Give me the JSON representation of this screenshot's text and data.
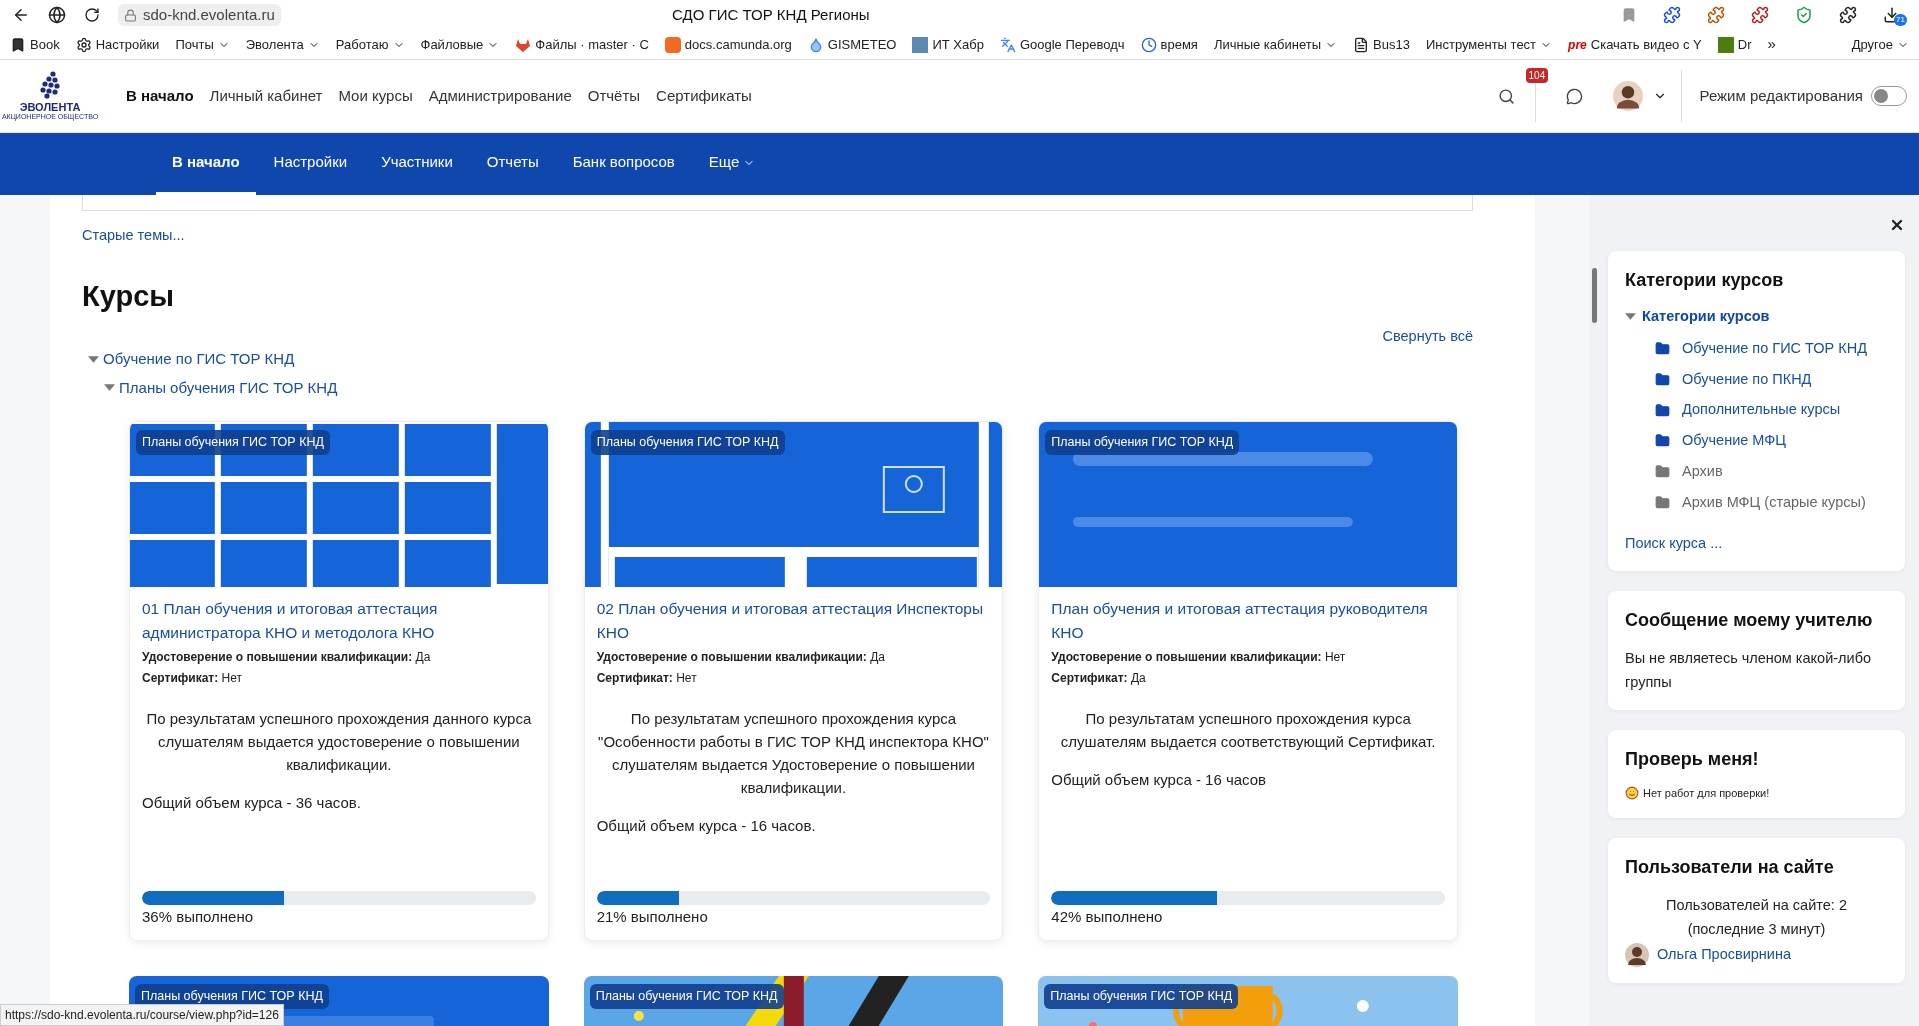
{
  "browser": {
    "url": "sdo-knd.evolenta.ru",
    "title": "СДО ГИС ТОР КНД Регионы",
    "downloads_badge": "71",
    "bookmarks": [
      {
        "label": "Book",
        "kind": "link"
      },
      {
        "label": "Настройки",
        "kind": "link"
      },
      {
        "label": "Почты",
        "kind": "folder"
      },
      {
        "label": "Эволента",
        "kind": "folder"
      },
      {
        "label": "Работаю",
        "kind": "folder"
      },
      {
        "label": "Файловые",
        "kind": "folder"
      },
      {
        "label": "Файлы · master · С",
        "kind": "link"
      },
      {
        "label": "docs.camunda.org",
        "kind": "link"
      },
      {
        "label": "GISMETEO",
        "kind": "link"
      },
      {
        "label": "ИТ Хабр",
        "kind": "link"
      },
      {
        "label": "Google Переводч",
        "kind": "link"
      },
      {
        "label": "время",
        "kind": "link"
      },
      {
        "label": "Личные кабинеты",
        "kind": "folder"
      },
      {
        "label": "Bus13",
        "kind": "link"
      },
      {
        "label": "Инструменты тест",
        "kind": "folder"
      },
      {
        "label": "Скачать видео с Y",
        "kind": "link",
        "icon_text": "pre"
      },
      {
        "label": "Dr",
        "kind": "link"
      }
    ],
    "more": "»",
    "other": "Другое"
  },
  "header": {
    "logo": "ЭВОЛЕНТА",
    "logo_sub": "АКЦИОНЕРНОЕ ОБЩЕСТВО",
    "nav": [
      {
        "label": "В начало",
        "selected": true
      },
      {
        "label": "Личный кабинет",
        "selected": false
      },
      {
        "label": "Мои курсы",
        "selected": false
      },
      {
        "label": "Администрирование",
        "selected": false
      },
      {
        "label": "Отчёты",
        "selected": false
      },
      {
        "label": "Сертификаты",
        "selected": false
      }
    ],
    "notifications": "104",
    "edit_mode": {
      "label": "Режим редактирования",
      "on": false
    }
  },
  "course_nav": [
    {
      "label": "В начало",
      "selected": true,
      "dropdown": false
    },
    {
      "label": "Настройки",
      "selected": false,
      "dropdown": false
    },
    {
      "label": "Участники",
      "selected": false,
      "dropdown": false
    },
    {
      "label": "Отчеты",
      "selected": false,
      "dropdown": false
    },
    {
      "label": "Банк вопросов",
      "selected": false,
      "dropdown": false
    },
    {
      "label": "Еще",
      "selected": false,
      "dropdown": true
    }
  ],
  "main": {
    "old_topics": "Старые темы...",
    "heading": "Курсы",
    "collapse_all": "Свернуть всё",
    "tree": [
      {
        "label": "Обучение по ГИС ТОР КНД",
        "expanded": true,
        "children": [
          {
            "label": "Планы обучения ГИС ТОР КНД",
            "expanded": true
          }
        ]
      }
    ],
    "cards": [
      {
        "badge": "Планы обучения ГИС ТОР КНД",
        "title": "01 План обучения и итоговая аттестация администратора КНО и методолога КНО",
        "fields": [
          {
            "label": "Удостоверение о повышении квалификации:",
            "value": "Да"
          },
          {
            "label": "Сертификат:",
            "value": "Нет"
          }
        ],
        "description": "По результатам успешного прохождения данного курса слушателям выдается удостоверение о повышении квалификации.",
        "hours": "Общий объем курса - 36 часов.",
        "level": 0.36,
        "progress_text": "36% выполнено"
      },
      {
        "badge": "Планы обучения ГИС ТОР КНД",
        "title": "02 План обучения и итоговая аттестация Инспекторы КНО",
        "fields": [
          {
            "label": "Удостоверение о повышении квалификации:",
            "value": "Да"
          },
          {
            "label": "Сертификат:",
            "value": "Нет"
          }
        ],
        "description": "По результатам успешного прохождения курса \"Особенности работы в ГИС ТОР КНД инспектора КНО\" слушателям выдается Удостоверение о повышении квалификации.",
        "hours": "Общий объем курса - 16 часов.",
        "level": 0.21,
        "progress_text": "21% выполнено"
      },
      {
        "badge": "Планы обучения ГИС ТОР КНД",
        "title": "План обучения и итоговая аттестация руководителя КНО",
        "fields": [
          {
            "label": "Удостоверение о повышении квалификации:",
            "value": "Нет"
          },
          {
            "label": "Сертификат:",
            "value": "Да"
          }
        ],
        "description": "По результатам успешного прохождения курса слушателям выдается соответствующий Сертификат.",
        "hours": "Общий объем курса - 16 часов",
        "level": 0.42,
        "progress_text": "42% выполнено"
      },
      {
        "badge": "Планы обучения ГИС ТОР КНД"
      },
      {
        "badge": "Планы обучения ГИС ТОР КНД"
      },
      {
        "badge": "Планы обучения ГИС ТОР КНД"
      }
    ]
  },
  "drawer": {
    "blocks": [
      {
        "kind": "categories",
        "title": "Категории курсов",
        "root": {
          "label": "Категории курсов",
          "expanded": true,
          "children": [
            {
              "label": "Обучение по ГИС ТОР КНД",
              "hidden": false
            },
            {
              "label": "Обучение по ПКНД",
              "hidden": false
            },
            {
              "label": "Дополнительные курсы",
              "hidden": false
            },
            {
              "label": "Обучение МФЦ",
              "hidden": false
            },
            {
              "label": "Архив",
              "hidden": true
            },
            {
              "label": "Архив МФЦ (старые курсы)",
              "hidden": true
            }
          ]
        },
        "link": "Поиск курса ..."
      },
      {
        "kind": "text",
        "title": "Сообщение моему учителю",
        "text": "Вы не являетесь членом какой-либо группы"
      },
      {
        "kind": "check",
        "title": "Проверь меня!",
        "text": "Нет работ для проверки!"
      },
      {
        "kind": "users",
        "title": "Пользователи на сайте",
        "text": "Пользователей на сайте: 2 (последние 3 минут)",
        "users": [
          "Ольга Просвирнина"
        ]
      }
    ]
  },
  "status_url": "https://sdo-knd.evolenta.ru/course/view.php?id=126"
}
